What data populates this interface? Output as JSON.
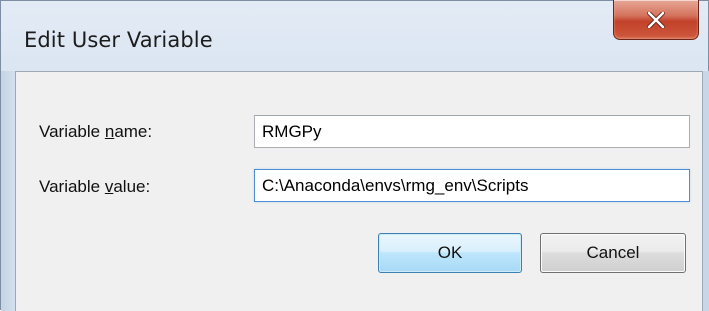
{
  "window": {
    "title": "Edit User Variable"
  },
  "form": {
    "name_label_before": "Variable ",
    "name_label_accel": "n",
    "name_label_after": "ame:",
    "name_value": "RMGPy",
    "value_label_before": "Variable ",
    "value_label_accel": "v",
    "value_label_after": "alue:",
    "value_value": "C:\\Anaconda\\envs\\rmg_env\\Scripts"
  },
  "buttons": {
    "ok_label": "OK",
    "cancel_label": "Cancel"
  },
  "icons": {
    "close": "close-icon"
  },
  "colors": {
    "close_button": "#c2412a",
    "ok_border": "#3c7fb1",
    "client_bg": "#f0f0f0",
    "frame": "#d3e0ef"
  }
}
